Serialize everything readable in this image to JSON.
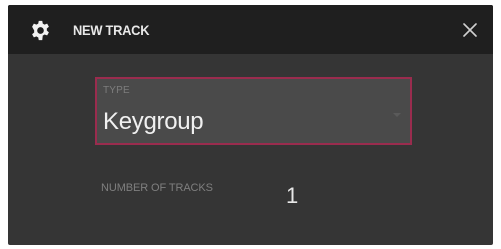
{
  "dialog": {
    "title": "NEW TRACK",
    "icon": "gear-icon",
    "close_icon": "close-icon"
  },
  "type_field": {
    "label": "TYPE",
    "value": "Keygroup",
    "accent_color": "#9a2c4e"
  },
  "tracks_field": {
    "label": "NUMBER OF TRACKS",
    "value": "1"
  }
}
